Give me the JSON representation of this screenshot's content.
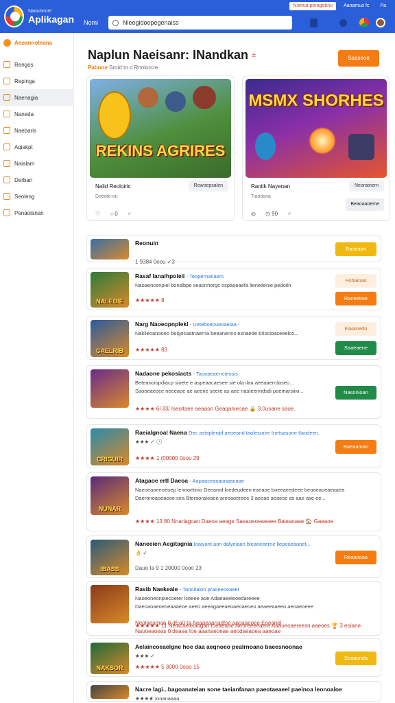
{
  "topstrip": [
    "Nsmua peragebnu",
    "Aanamuo fc",
    "Pa"
  ],
  "brand": {
    "sub": "Naouhirnel",
    "name": "Aplikagan"
  },
  "sidebar": {
    "heading": "Aeoannoteana",
    "items": [
      "Rengos",
      "Repinga",
      "Naenagia",
      "Naneda",
      "Naebaris",
      "Aqiakpt",
      "Naialam",
      "Derban",
      "Seoleng",
      "Penaolanan"
    ],
    "active_index": 2
  },
  "topbar": {
    "home": "Nomi",
    "search_value": "Nleogidoopegenaiss"
  },
  "page": {
    "title": "Naplun Naeisanr: INandkan",
    "tag": "=",
    "sub_highlight": "Pabnoe",
    "sub": "Sroid to d Rnnlorcre",
    "cta": "Saasooe"
  },
  "featured": [
    {
      "art_text": "REKINS AGRIRES",
      "name": "Nalid Reoloiric",
      "pill": "Rowoepsalen",
      "meta": "Doeoto-ou",
      "actions": [
        "♡",
        "○ 0",
        "♂"
      ],
      "button": ""
    },
    {
      "art_text": "MSMX SHORHES",
      "name": "Rantik Nayenan",
      "pill": "Neoratnern",
      "meta": "Tianoona",
      "actions": [
        "◎",
        "◷ 90",
        "♂"
      ],
      "button": "Beaoaaoeme"
    }
  ],
  "rows": [
    {
      "title": "Reonuin",
      "sub": "",
      "desc": "",
      "stats": "1 9384  0oou ✓3",
      "button": "Raseaon",
      "color": "#efb911",
      "thumb": "",
      "ghost": ""
    },
    {
      "title": "Rasaf Ianalhpoleil",
      "sub": "- Teopernanaers",
      "desc": "Naoaencenpiel bonslbpe seaonnorgs ospaoeaefa lienetlenie pedoiln",
      "stats": "★★★★★ 8",
      "button": "Raneekoe",
      "color": "#f57c12",
      "thumb": "NALEBIE",
      "ghost": "Fohaioas"
    },
    {
      "title": "Narg Naoeopnplekl",
      "sub": "- Ueteboeoueoaelaa -",
      "desc": "Naklieoanooeo beigocaatnaerna beeanenns esnaede briocioaceeelco...",
      "stats": "★★★★★ 83",
      "button": "Saaeaene",
      "color": "#208a47",
      "thumb": "CAELRIB",
      "ghost": "Fiaianedo"
    },
    {
      "title": "Nadaone pekosiacts",
      "sub": "- Taooaeaerrcieosis",
      "desc": "Beteanoiopdiacp sioete e aspeaacaesee sie ola ilaa aeeaaerrdaseo...",
      "desc2": "Saooeaeoce neeeaoe ae aeerie seere as aee nasteenndsdi poemarsiiio...",
      "stats": "★★★★ 6l 33/  Iseoltaee aeaaon Geaqanieoae 🔒 3.0usane saoe.",
      "button": "Nasonioan",
      "color": "#208a47",
      "thumb": "",
      "ghost": ""
    },
    {
      "title": "Raeialgnoal Naena",
      "sub": "Dec astaplerqd aeoeand taolesraire  Inetsauone tlaodeen.",
      "desc": "★★★ ✓ 🕐",
      "stats": "★★★★ 1 (00000  0oou 29",
      "button": "Baeaatnan",
      "color": "#f57c12",
      "thumb": "CRIGUIR",
      "ghost": ""
    },
    {
      "title": "Atagaoe ertl Daeoa",
      "sub": "- Aapaaceaoaonaanaae",
      "desc": "Naeoeaoeeoeoep lennoetinio Deeamd loedeudeen eaeaoe boeeaeedeee beoaeaoeaeaaea",
      "desc2": "Daeronoaoeaeoe sea Bteraorateaee areoaoereee 3 aeeae aeaese as aae ase ee...",
      "stats": "★★★★ 13 80 Nnarlagoan  Daeoa aeage Saeaoeoeaeaee Baieaoaae  🏠 Gaeaoe",
      "button": "",
      "color": "",
      "thumb": "NUNAR",
      "ghost": ""
    },
    {
      "title": "Naneeien Aegitagnia",
      "sub": "Ioaiyant aon dalyeiaan bleaneeerne liepooeaanet...",
      "desc": "👌 ✓",
      "stats": "Dauo Ia 9 1 20000  0ooo 23",
      "button": "Reaasoaa",
      "color": "#f57c12",
      "thumb": "IBASS",
      "ghost": ""
    },
    {
      "title": "Rasib Naekeale",
      "sub": "- Tanoitaion praoeeooaeet",
      "desc": "Naoeoneonpiecoeter lceeee aoe Adaeaeeleoedareeee",
      "desc2": "Daeoaoaeoeoeaaaeoe aeeo aeeagaeeaeoaeoaeoeo aeaeeaaeeo aeoaeoeee",
      "stats": "★★★★★ 11 Nelacaeieoiogan  Ioeaeaae Nenreeeeaere Aaaueoaereesn aaeoes 🏆 3 eoiane",
      "button": "",
      "color": "",
      "thumb": "",
      "ghost": "Neolaeamoe  0.dEa0  ta Aeaaeaanadtse aeoaaeoee Eoeanel",
      "stats2": "Naooeaoeas 0.deaea Ioe aaanaeoeae aeodaeaoea aaeoae"
    },
    {
      "title": "Aelaincoeaelgne hoe daa aeqnoeo pealrnoano baeesnoonae",
      "sub": "",
      "desc": "★★★ ✓",
      "stats": "★★★★★ 5 3000  0ouo 15",
      "button": "Seaaenda",
      "color": "#efb911",
      "thumb": "NAKSOR",
      "ghost": ""
    },
    {
      "title": "Nacre Iagi...bagoanateian sone taeianfanan paeotaeaeel paeinoa leonoaloe",
      "sub": "",
      "desc": "★★★★ Ionanaaaa",
      "stats": "",
      "button": "",
      "color": "",
      "thumb": "",
      "ghost": ""
    }
  ]
}
